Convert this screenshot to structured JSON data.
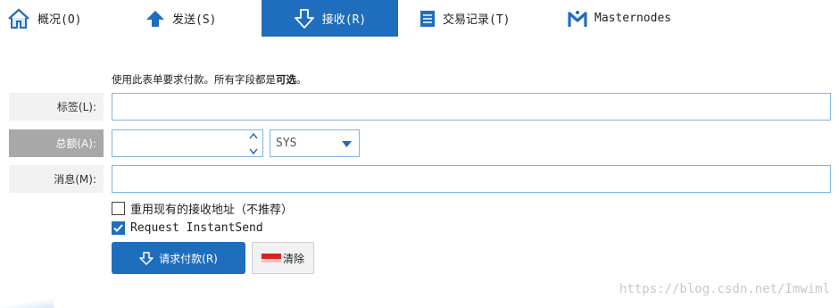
{
  "toolbar": {
    "tabs": [
      {
        "label": "概况(O)",
        "icon": "home-icon"
      },
      {
        "label": "发送(S)",
        "icon": "arrow-up-icon"
      },
      {
        "label": "接收(R)",
        "icon": "arrow-down-icon"
      },
      {
        "label": "交易记录(T)",
        "icon": "list-icon"
      },
      {
        "label": "Masternodes",
        "icon": "masternode-icon"
      }
    ],
    "active_tab": "接收(R)"
  },
  "form": {
    "hint_prefix": "使用此表单要求付款。所有字段都是",
    "hint_emphasis": "可选",
    "hint_suffix": "。",
    "label": {
      "label": "标签(L):",
      "value": ""
    },
    "amount": {
      "label": "总额(A):",
      "value": "",
      "unit": "SYS"
    },
    "message": {
      "label": "消息(M):",
      "value": ""
    },
    "reuse_address": {
      "label": "重用现有的接收地址（不推荐）",
      "checked": false
    },
    "instant_send": {
      "label": "Request InstantSend",
      "checked": true
    },
    "request_button": "请求付款(R)",
    "clear_button": "清除"
  },
  "watermark": "https://blog.csdn.net/Imwiml",
  "colors": {
    "accent": "#1f6ebd",
    "field_border": "#7fb4e6",
    "label_bg": "#f2f2f2",
    "label_active_bg": "#a8a8a8"
  }
}
